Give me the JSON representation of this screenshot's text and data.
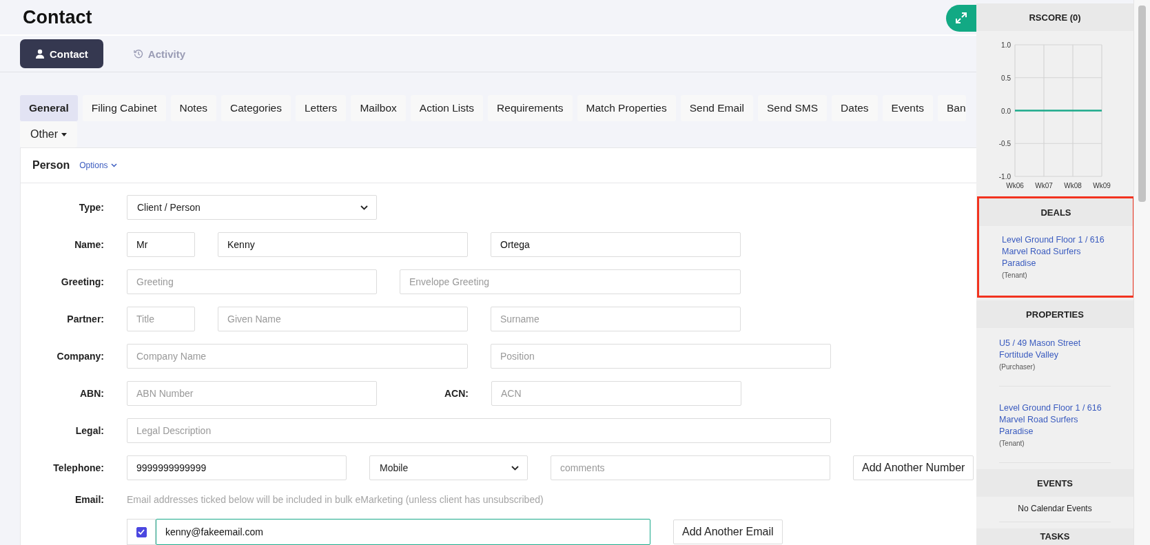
{
  "page": {
    "title": "Contact"
  },
  "view_tabs": [
    {
      "label": "Contact",
      "selected": true
    },
    {
      "label": "Activity",
      "selected": false
    }
  ],
  "tabs": [
    {
      "label": "General",
      "selected": true
    },
    {
      "label": "Filing Cabinet",
      "selected": false
    },
    {
      "label": "Notes",
      "selected": false
    },
    {
      "label": "Categories",
      "selected": false
    },
    {
      "label": "Letters",
      "selected": false
    },
    {
      "label": "Mailbox",
      "selected": false
    },
    {
      "label": "Action Lists",
      "selected": false
    },
    {
      "label": "Requirements",
      "selected": false
    },
    {
      "label": "Match Properties",
      "selected": false
    },
    {
      "label": "Send Email",
      "selected": false
    },
    {
      "label": "Send SMS",
      "selected": false
    },
    {
      "label": "Dates",
      "selected": false
    },
    {
      "label": "Events",
      "selected": false
    },
    {
      "label": "Ban",
      "selected": false
    }
  ],
  "more_tab": {
    "label": "Other"
  },
  "card": {
    "title": "Person",
    "options": "Options"
  },
  "form_rows": [
    {
      "label": "Type:",
      "fields": [
        {
          "kind": "select",
          "value": "Client / Person"
        }
      ]
    },
    {
      "label": "Name:",
      "fields": [
        {
          "kind": "input",
          "value": "Mr"
        },
        {
          "kind": "input",
          "value": "Kenny"
        },
        {
          "kind": "input",
          "value": "Ortega"
        }
      ]
    },
    {
      "label": "Greeting:",
      "fields": [
        {
          "kind": "input",
          "placeholder": "Greeting"
        },
        {
          "kind": "input",
          "placeholder": "Envelope Greeting"
        }
      ]
    },
    {
      "label": "Partner:",
      "fields": [
        {
          "kind": "input",
          "placeholder": "Title"
        },
        {
          "kind": "input",
          "placeholder": "Given Name"
        },
        {
          "kind": "input",
          "placeholder": "Surname"
        }
      ]
    },
    {
      "label": "Company:",
      "fields": [
        {
          "kind": "input",
          "placeholder": "Company Name"
        },
        {
          "kind": "input",
          "placeholder": "Position"
        }
      ]
    },
    {
      "label": "ABN:",
      "fields": [
        {
          "kind": "input",
          "placeholder": "ABN Number"
        },
        {
          "kind": "label",
          "value": "ACN:"
        },
        {
          "kind": "input",
          "placeholder": "ACN"
        }
      ]
    },
    {
      "label": "Legal:",
      "fields": [
        {
          "kind": "input",
          "placeholder": "Legal Description"
        }
      ]
    },
    {
      "label": "Telephone:",
      "fields": [
        {
          "kind": "input",
          "value": "9999999999999"
        },
        {
          "kind": "select",
          "value": "Mobile"
        },
        {
          "kind": "input",
          "placeholder": "comments"
        },
        {
          "kind": "button",
          "value": "Add Another Number"
        }
      ]
    }
  ],
  "email": {
    "label": "Email:",
    "note": "Email addresses ticked below will be included in bulk eMarketing (unless client has unsubscribed)",
    "entries": [
      {
        "checked": true,
        "value": "kenny@fakeemail.com"
      }
    ],
    "add_button": "Add Another Email"
  },
  "sidebar": {
    "rscore": {
      "title": "RSCORE (0)",
      "chart_data": {
        "type": "line",
        "categories": [
          "Wk06",
          "Wk07",
          "Wk08",
          "Wk09"
        ],
        "grid": true,
        "series": [
          {
            "color": "#1aaa8a",
            "values": [
              0,
              0,
              0,
              0
            ]
          }
        ],
        "ylim": [
          -1,
          1
        ],
        "yticks": [
          {
            "value": 1,
            "label": "1.0"
          },
          {
            "value": 0.5,
            "label": "0.5"
          },
          {
            "value": 0,
            "label": "0.0"
          },
          {
            "value": -0.5,
            "label": "-0.5"
          },
          {
            "value": -1,
            "label": "-1.0"
          }
        ]
      }
    },
    "deals": {
      "title": "DEALS",
      "highlighted": true,
      "items": [
        {
          "address": "Level Ground Floor 1 / 616 Marvel Road Surfers Paradise",
          "role": "(Tenant)"
        }
      ]
    },
    "properties": {
      "title": "PROPERTIES",
      "items": [
        {
          "address": "U5 / 49 Mason Street Fortitude Valley",
          "role": "(Purchaser)"
        },
        {
          "address": "Level Ground Floor 1 / 616 Marvel Road Surfers Paradise",
          "role": "(Tenant)"
        }
      ]
    },
    "events": {
      "title": "EVENTS",
      "empty": "No Calendar Events"
    },
    "tasks": {
      "title": "TASKS"
    }
  }
}
